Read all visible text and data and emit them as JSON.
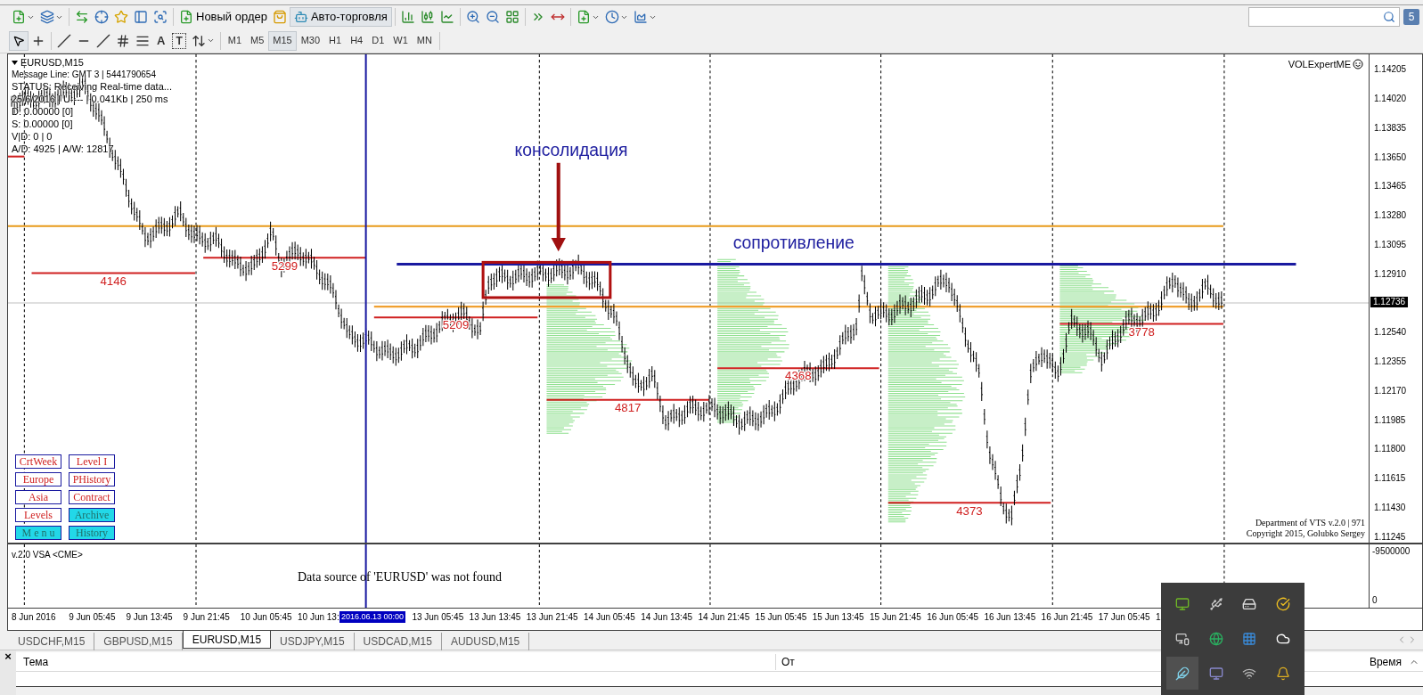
{
  "toolbar": {
    "new_order": "Новый ордер",
    "auto_trading": "Авто-торговля",
    "text_tool": "A",
    "label_tool": "T",
    "notifications": "5",
    "timeframes": [
      {
        "label": "M1",
        "selected": false
      },
      {
        "label": "M5",
        "selected": false
      },
      {
        "label": "M15",
        "selected": true
      },
      {
        "label": "M30",
        "selected": false
      },
      {
        "label": "H1",
        "selected": false
      },
      {
        "label": "H4",
        "selected": false
      },
      {
        "label": "D1",
        "selected": false
      },
      {
        "label": "W1",
        "selected": false
      },
      {
        "label": "MN",
        "selected": false
      }
    ]
  },
  "chart": {
    "symbol": "EURUSD,M15",
    "info_lines": [
      {
        "text": "Message Line: GMT 3 | 5441790654",
        "kind": "small"
      },
      {
        "text": "STATUS:  Receiving Real-time data...",
        "kind": "large"
      },
      {
        "text": "25/6/2016 | U---- | 0.041Kb | 250 ms",
        "kind": "large"
      },
      {
        "text": "D: 0.00000  [0]",
        "kind": "large"
      },
      {
        "text": "S: 0.00000  [0]",
        "kind": "large"
      },
      {
        "text": "V|D: 0 | 0",
        "kind": "large"
      },
      {
        "text": "A/D: 4925 | A/W: 12817",
        "kind": "large"
      }
    ],
    "expert": "VOLExpertME",
    "consolidation": "консолидация",
    "resistance": "сопротивление",
    "levels": [
      "4146",
      "5299",
      "5209",
      "4817",
      "4368",
      "4373",
      "3778"
    ],
    "buttons": [
      {
        "label": "CrtWeek",
        "active": false
      },
      {
        "label": "Level I",
        "active": false
      },
      {
        "label": "Europe",
        "active": false
      },
      {
        "label": "PHistory",
        "active": false
      },
      {
        "label": "Asia",
        "active": false
      },
      {
        "label": "Contract",
        "active": false
      },
      {
        "label": "Levels",
        "active": false
      },
      {
        "label": "Archive",
        "active": true
      },
      {
        "label": "M e n u",
        "active": true
      },
      {
        "label": "History",
        "active": true
      }
    ],
    "copyright": [
      "Department of VTS  v.2.0 | 971",
      "Copyright 2015, Golubko Sergey"
    ],
    "price_axis": [
      "1.14205",
      "1.14020",
      "1.13835",
      "1.13650",
      "1.13465",
      "1.13280",
      "1.13095",
      "1.12910",
      "1.12540",
      "1.12355",
      "1.12170",
      "1.11985",
      "1.11800",
      "1.11615",
      "1.11430",
      "1.11245"
    ],
    "current_price": "1.12736"
  },
  "indicator": {
    "title": "v.2.0 VSA <CME>",
    "message": "Data source of 'EURUSD' was not found",
    "axis": [
      "-9500000",
      "0"
    ]
  },
  "time_axis": [
    {
      "text": "8 Jun 2016",
      "kind": "tick"
    },
    {
      "text": "9 Jun 05:45",
      "kind": "tick"
    },
    {
      "text": "9 Jun 13:45",
      "kind": "tick"
    },
    {
      "text": "9 Jun 21:45",
      "kind": "tick"
    },
    {
      "text": "10 Jun 05:45",
      "kind": "tick"
    },
    {
      "text": "10 Jun 13:",
      "kind": "tick"
    },
    {
      "text": "2016.06.13 00:00",
      "kind": "cursor"
    },
    {
      "text": "13 Jun 05:45",
      "kind": "tick"
    },
    {
      "text": "13 Jun 13:45",
      "kind": "tick"
    },
    {
      "text": "13 Jun 21:45",
      "kind": "tick"
    },
    {
      "text": "14 Jun 05:45",
      "kind": "tick"
    },
    {
      "text": "14 Jun 13:45",
      "kind": "tick"
    },
    {
      "text": "14 Jun 21:45",
      "kind": "tick"
    },
    {
      "text": "15 Jun 05:45",
      "kind": "tick"
    },
    {
      "text": "15 Jun 13:45",
      "kind": "tick"
    },
    {
      "text": "15 Jun 21:45",
      "kind": "tick"
    },
    {
      "text": "16 Jun 05:45",
      "kind": "tick"
    },
    {
      "text": "16 Jun 13:45",
      "kind": "tick"
    },
    {
      "text": "16 Jun 21:45",
      "kind": "tick"
    },
    {
      "text": "17 Jun 05:45",
      "kind": "tick"
    },
    {
      "text": "1",
      "kind": "tick"
    }
  ],
  "tabs": [
    {
      "label": "USDCHF,M15",
      "selected": false
    },
    {
      "label": "GBPUSD,M15",
      "selected": false
    },
    {
      "label": "EURUSD,M15",
      "selected": true
    },
    {
      "label": "USDJPY,M15",
      "selected": false
    },
    {
      "label": "USDCAD,M15",
      "selected": false
    },
    {
      "label": "AUDUSD,M15",
      "selected": false
    }
  ],
  "terminal": {
    "close": "×",
    "columns": [
      "Тема",
      "От",
      "Время"
    ]
  }
}
